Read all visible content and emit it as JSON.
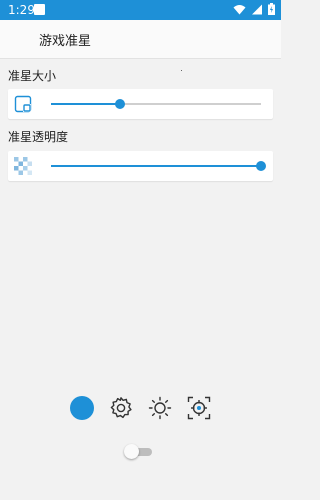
{
  "status_bar": {
    "time": "1:29",
    "icons": [
      "notification-square-icon",
      "wifi-icon",
      "signal-icon",
      "battery-icon"
    ]
  },
  "app_bar": {
    "title": "游戏准星"
  },
  "settings": {
    "size": {
      "label": "准星大小",
      "value_fraction": 0.33
    },
    "opacity": {
      "label": "准星透明度",
      "value_fraction": 1.0
    }
  },
  "toolbar": {
    "color_picker": "color-dot-icon",
    "items": [
      "gear-icon",
      "brightness-icon",
      "crosshair-icon"
    ]
  },
  "toggle": {
    "state": "off"
  },
  "colors": {
    "accent": "#1e90d7",
    "background": "#f2f2f2"
  }
}
